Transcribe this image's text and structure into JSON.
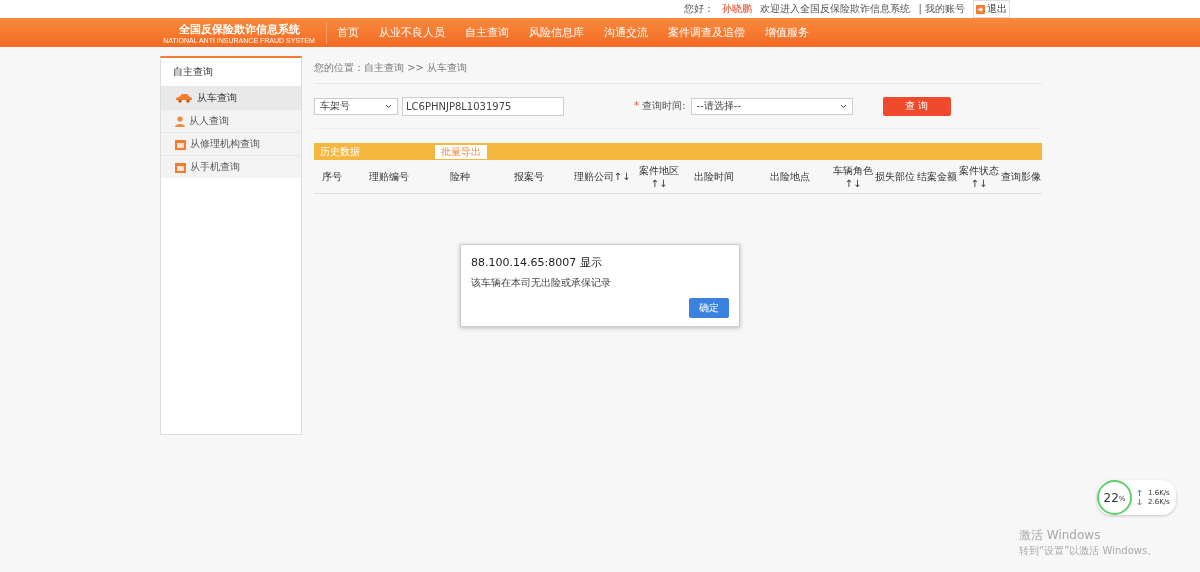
{
  "top_bar": {
    "greeting": "您好：",
    "user_name": "孙晓鹏",
    "welcome": "欢迎进入全国反保险欺诈信息系统",
    "account_link": "| 我的账号",
    "logout_button": "退出"
  },
  "header": {
    "logo_title": "全国反保险欺诈信息系统",
    "logo_subtitle": "NATIONAL ANTI INSURANCE FRAUD SYSTEM",
    "nav": [
      {
        "label": "首页",
        "selected": false
      },
      {
        "label": "从业不良人员",
        "selected": false
      },
      {
        "label": "自主查询",
        "selected": false
      },
      {
        "label": "风险信息库",
        "selected": false
      },
      {
        "label": "沟通交流",
        "selected": false
      },
      {
        "label": "案件调查及追偿",
        "selected": false
      },
      {
        "label": "增值服务",
        "selected": false
      }
    ]
  },
  "sidebar": {
    "title": "自主查询",
    "items": [
      {
        "label": "从车查询",
        "kind": "car",
        "selected": true
      },
      {
        "label": "从人查询",
        "kind": "person",
        "selected": false
      },
      {
        "label": "从修理机构查询",
        "kind": "calendar",
        "selected": false
      },
      {
        "label": "从手机查询",
        "kind": "calendar",
        "selected": false
      }
    ]
  },
  "breadcrumb": "您的位置：自主查询 >> 从车查询",
  "search": {
    "type_select": "车架号",
    "vin_value": "LC6PHNJP8L1031975",
    "required_mark": "*",
    "time_label": "查询时间:",
    "time_select": "--请选择--",
    "query_button": "查 询"
  },
  "history_bar": {
    "title": "历史数据",
    "export_button": "批量导出"
  },
  "table": {
    "columns": [
      "序号",
      "理赔编号",
      "险种",
      "报案号",
      "理赔公司↑↓",
      "案件地区↑↓",
      "出险时间",
      "出险地点",
      "车辆角色↑↓",
      "损失部位",
      "结案金额",
      "案件状态↑↓",
      "查询影像"
    ]
  },
  "dialog": {
    "title": "88.100.14.65:8007 显示",
    "message": "该车辆在本司无出险或承保记录",
    "ok_button": "确定"
  },
  "network_widget": {
    "percent": "22",
    "unit": "%",
    "upload": "1.6K/s",
    "download": "2.6K/s"
  },
  "activation": {
    "title": "激活 Windows",
    "hint": "转到“设置”以激活 Windows。"
  }
}
